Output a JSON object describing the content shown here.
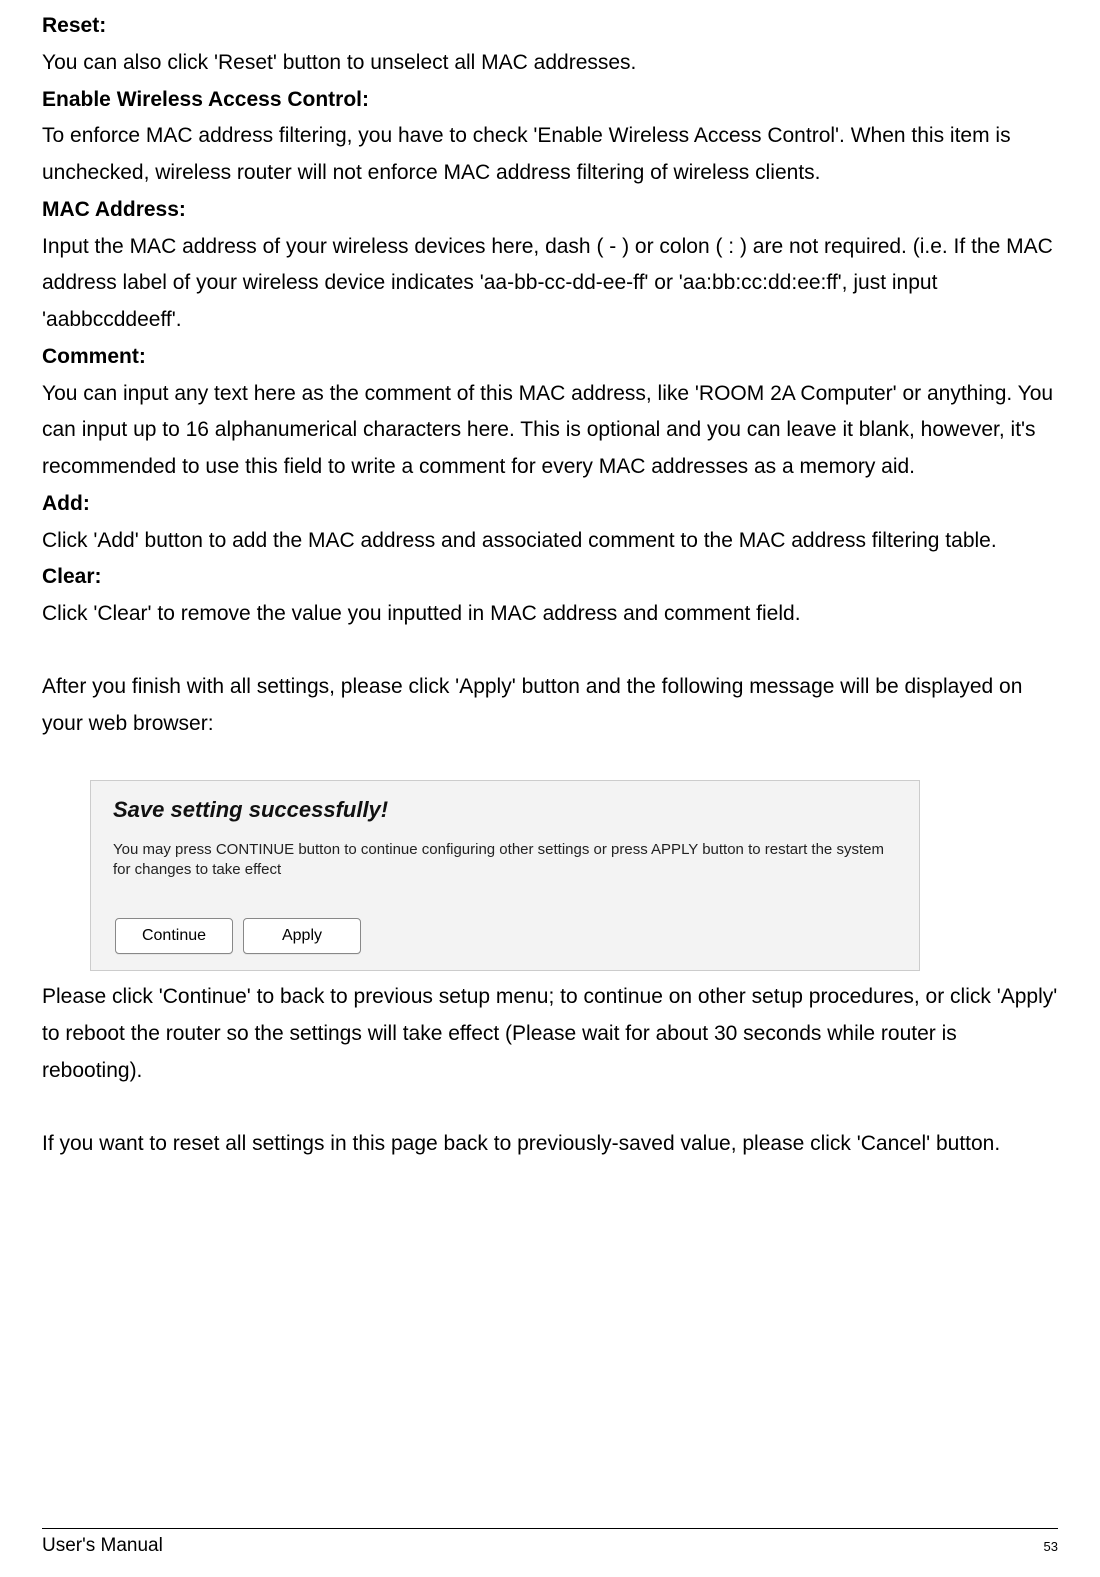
{
  "sections": {
    "reset": {
      "heading": "Reset:",
      "body": "You can also click 'Reset' button to unselect all MAC addresses."
    },
    "enable": {
      "heading": "Enable Wireless Access Control:",
      "body": "To enforce MAC address filtering, you have to check 'Enable Wireless Access Control'. When this item is unchecked, wireless router will not enforce MAC address filtering of wireless clients."
    },
    "mac": {
      "heading": "MAC Address:",
      "body": "Input the MAC address of your wireless devices here, dash ( - ) or colon ( : ) are not required. (i.e. If the MAC address label of your wireless device indicates 'aa-bb-cc-dd-ee-ff' or 'aa:bb:cc:dd:ee:ff', just input 'aabbccddeeff'."
    },
    "comment": {
      "heading": "Comment:",
      "body": "You can input any text here as the comment of this MAC address, like 'ROOM 2A Computer' or anything. You can input up to 16 alphanumerical characters here. This is optional and you can leave it blank, however, it's recommended to use this field to write a comment for every MAC addresses as a memory aid."
    },
    "add": {
      "heading": "Add:",
      "body": "Click 'Add' button to add the MAC address and associated comment to the MAC address filtering table."
    },
    "clear": {
      "heading": "Clear:",
      "body": "Click 'Clear' to remove the value you inputted in MAC address and comment field."
    }
  },
  "apply_intro": "After you finish with all settings, please click 'Apply' button and the following message will be displayed on your web browser:",
  "dialog": {
    "title": "Save setting successfully!",
    "text": "You may press CONTINUE button to continue configuring other settings or press APPLY button to restart the system for changes to take effect",
    "continue_label": "Continue",
    "apply_label": "Apply"
  },
  "post_dialog_1": "Please click 'Continue' to back to previous setup menu; to continue on other setup procedures, or click 'Apply' to reboot the router so the settings will take effect (Please wait for about 30 seconds while router is rebooting).",
  "post_dialog_2": "If you want to reset all settings in this page back to previously-saved value, please click 'Cancel' button.",
  "footer": {
    "left": "User's Manual",
    "right": "53"
  }
}
